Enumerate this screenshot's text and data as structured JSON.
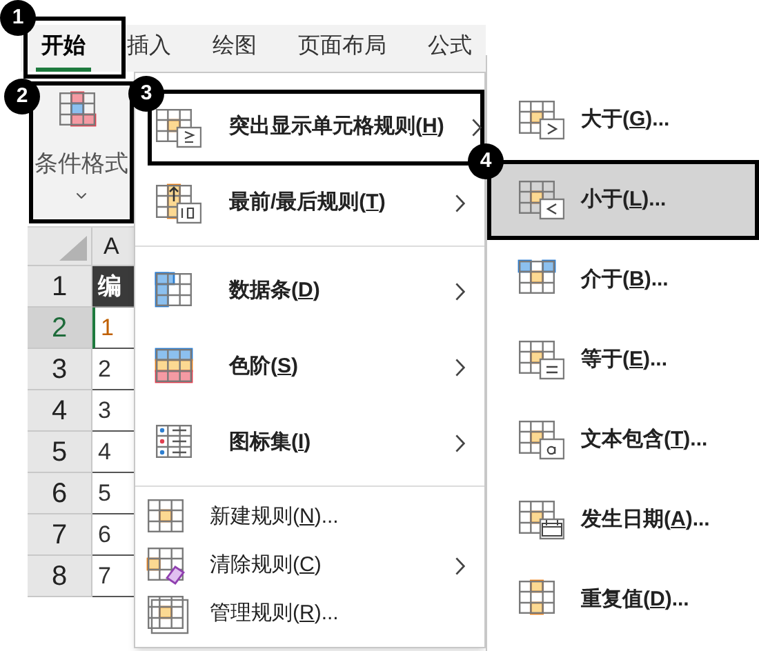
{
  "tabs": [
    {
      "label": "开始",
      "selected": true
    },
    {
      "label": "插入",
      "selected": false
    },
    {
      "label": "绘图",
      "selected": false
    },
    {
      "label": "页面布局",
      "selected": false
    },
    {
      "label": "公式",
      "selected": false
    }
  ],
  "ribbon_button": {
    "label": "条件格式"
  },
  "sheet": {
    "column_header": "A",
    "rows": [
      {
        "number": "1",
        "cell": "编",
        "selected": false,
        "header": true
      },
      {
        "number": "2",
        "cell": "1",
        "selected": true,
        "header": false
      },
      {
        "number": "3",
        "cell": "2",
        "selected": false,
        "header": false
      },
      {
        "number": "4",
        "cell": "3",
        "selected": false,
        "header": false
      },
      {
        "number": "5",
        "cell": "4",
        "selected": false,
        "header": false
      },
      {
        "number": "6",
        "cell": "5",
        "selected": false,
        "header": false
      },
      {
        "number": "7",
        "cell": "6",
        "selected": false,
        "header": false
      },
      {
        "number": "8",
        "cell": "7",
        "selected": false,
        "header": false
      }
    ]
  },
  "menu": {
    "sections": [
      [
        {
          "label": "突出显示单元格规则(H)",
          "kind": "large",
          "submenu": true,
          "callout": "3"
        },
        {
          "label": "最前/最后规则(T)",
          "kind": "large",
          "submenu": true
        }
      ],
      [
        {
          "label": "数据条(D)",
          "kind": "large",
          "submenu": true
        },
        {
          "label": "色阶(S)",
          "kind": "large",
          "submenu": true
        },
        {
          "label": "图标集(I)",
          "kind": "large",
          "submenu": true
        }
      ],
      [
        {
          "label": "新建规则(N)...",
          "kind": "small",
          "submenu": false
        },
        {
          "label": "清除规则(C)",
          "kind": "small",
          "submenu": true
        },
        {
          "label": "管理规则(R)...",
          "kind": "small",
          "submenu": false
        }
      ]
    ]
  },
  "submenu": {
    "items": [
      {
        "label": "大于(G)...",
        "selected": false
      },
      {
        "label": "小于(L)...",
        "selected": true,
        "callout": "4"
      },
      {
        "label": "介于(B)...",
        "selected": false
      },
      {
        "label": "等于(E)...",
        "selected": false
      },
      {
        "label": "文本包含(T)...",
        "selected": false
      },
      {
        "label": "发生日期(A)...",
        "selected": false
      },
      {
        "label": "重复值(D)...",
        "selected": false
      }
    ]
  },
  "callouts": [
    "1",
    "2"
  ]
}
